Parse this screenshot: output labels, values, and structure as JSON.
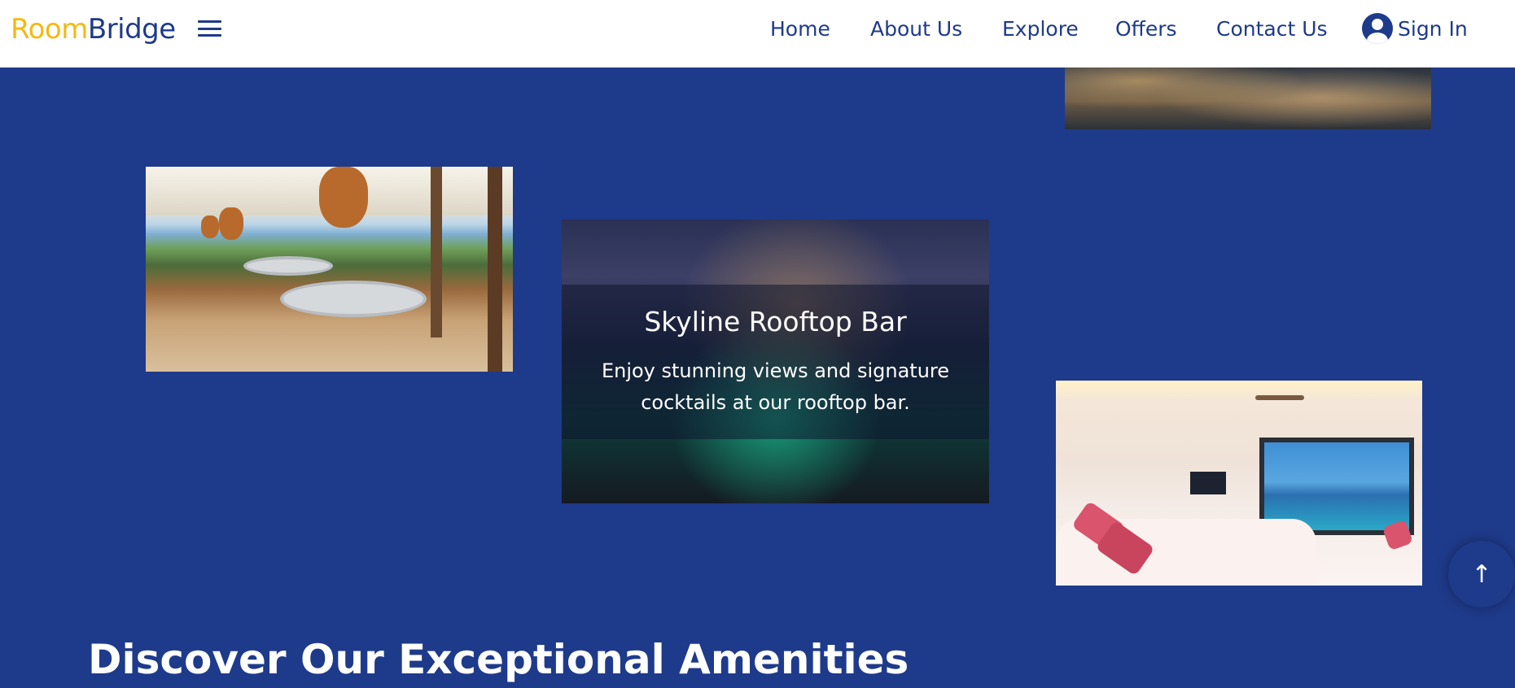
{
  "brand": {
    "part1": "Room",
    "part2": "Bridge",
    "color_primary": "#f5b90f",
    "color_secondary": "#1e3a8a"
  },
  "nav": {
    "menu_icon": "hamburger-menu-icon",
    "links": [
      "Home",
      "About Us",
      "Explore",
      "Offers",
      "Contact Us"
    ],
    "signin": {
      "label": "Sign In",
      "icon": "user-circle-icon"
    }
  },
  "gallery": {
    "featured": {
      "title": "Skyline Rooftop Bar",
      "description": "Enjoy stunning views and signature cocktails at our rooftop bar."
    },
    "images": [
      "pool-deck-night",
      "beach-restaurant",
      "rooftop-bar",
      "ocean-view-bedroom"
    ]
  },
  "scroll_top": {
    "icon": "arrow-up-icon",
    "symbol": "↑"
  },
  "section": {
    "heading": "Discover Our Exceptional Amenities"
  },
  "colors": {
    "page_background": "#1e3a8a",
    "navbar_background": "#ffffff"
  }
}
